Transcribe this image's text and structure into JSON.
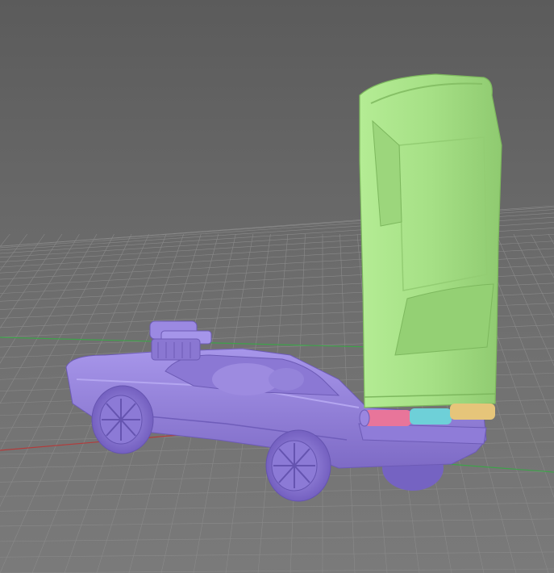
{
  "viewport": {
    "background_top": "#5b5b5b",
    "background_bottom": "#7a7a7a"
  },
  "build_plate": {
    "grid_color": "#8a8a8a",
    "x_axis_color": "#b23b3b",
    "y_axis_color": "#3ea24a"
  },
  "models": [
    {
      "id": "car-body",
      "description_icon": "car-chassis-icon",
      "color": "#9a86e0",
      "shade": "#7f6cc8"
    },
    {
      "id": "car-roof-shell",
      "description_icon": "car-shell-icon",
      "color": "#a6e086",
      "shade": "#8fca70"
    }
  ],
  "hinge_segments": [
    {
      "color": "#e8759a"
    },
    {
      "color": "#6ed0d8"
    },
    {
      "color": "#e6c57a"
    }
  ]
}
